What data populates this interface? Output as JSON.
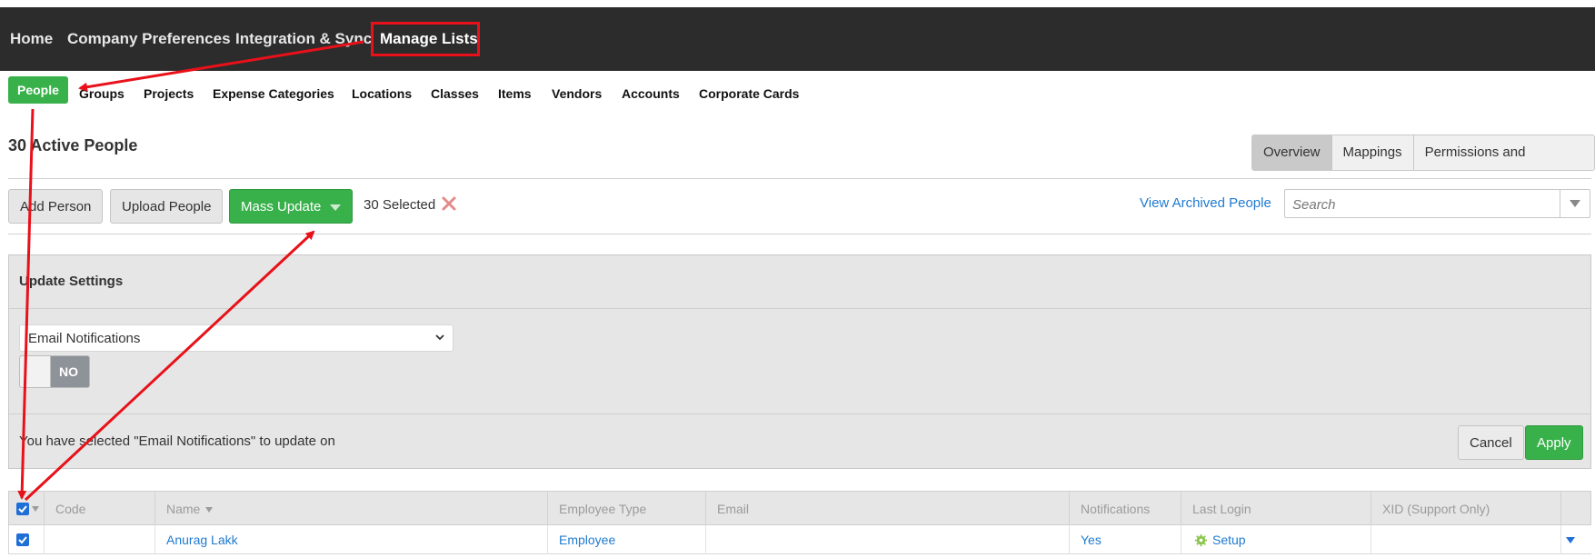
{
  "top_nav": {
    "items": [
      {
        "label": "Home"
      },
      {
        "label": "Company Preferences"
      },
      {
        "label": "Integration & Sync"
      },
      {
        "label": "Manage Lists"
      }
    ]
  },
  "sub_nav": {
    "items": [
      {
        "label": "People"
      },
      {
        "label": "Groups"
      },
      {
        "label": "Projects"
      },
      {
        "label": "Expense Categories"
      },
      {
        "label": "Locations"
      },
      {
        "label": "Classes"
      },
      {
        "label": "Items"
      },
      {
        "label": "Vendors"
      },
      {
        "label": "Accounts"
      },
      {
        "label": "Corporate Cards"
      }
    ]
  },
  "page": {
    "title": "30 Active People",
    "view_tabs": [
      {
        "label": "Overview"
      },
      {
        "label": "Mappings"
      },
      {
        "label": "Permissions and Approvers"
      }
    ]
  },
  "toolbar": {
    "add_person": "Add Person",
    "upload_people": "Upload People",
    "mass_update": "Mass Update",
    "selected_text": "30 Selected",
    "view_archived": "View Archived People",
    "search_placeholder": "Search"
  },
  "update_panel": {
    "title": "Update Settings",
    "setting_select": "Email Notifications",
    "toggle_label": "NO",
    "message": "You have selected \"Email Notifications\" to update on",
    "cancel": "Cancel",
    "apply": "Apply"
  },
  "table": {
    "columns": [
      {
        "label": "Code"
      },
      {
        "label": "Name"
      },
      {
        "label": "Employee Type"
      },
      {
        "label": "Email"
      },
      {
        "label": "Notifications"
      },
      {
        "label": "Last Login"
      },
      {
        "label": "XID (Support Only)"
      }
    ],
    "rows": [
      {
        "code": "",
        "name": "Anurag Lakk",
        "employee_type": "Employee",
        "email": "",
        "notifications": "Yes",
        "last_login": "Setup",
        "xid": ""
      }
    ]
  },
  "colors": {
    "nav_bg": "#2c2c2c",
    "accent_green": "#38b14b",
    "link_blue": "#1f7ad0",
    "annotation_red": "#e8111a"
  }
}
